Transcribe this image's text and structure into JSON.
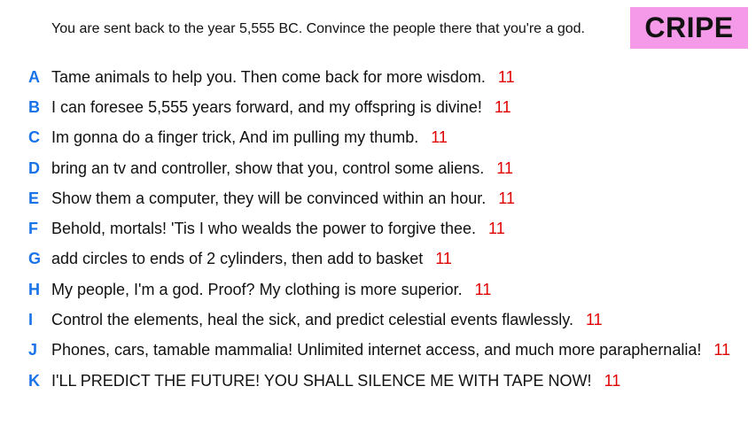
{
  "prompt": "You are sent back to the year 5,555 BC. Convince the people there that you're a god.",
  "logo": "CRIPE",
  "colors": {
    "letter": "#1a73e8",
    "score": "#e00000",
    "logo_bg": "#f49ae8"
  },
  "answers": [
    {
      "letter": "A",
      "text": "Tame animals to help you. Then come back for more wisdom.",
      "score": "11"
    },
    {
      "letter": "B",
      "text": "I can foresee 5,555 years forward, and my offspring is divine!",
      "score": "11"
    },
    {
      "letter": "C",
      "text": "Im gonna do a finger trick, And im pulling my thumb.",
      "score": "11"
    },
    {
      "letter": "D",
      "text": "bring an tv and controller, show that you, control some aliens.",
      "score": "11"
    },
    {
      "letter": "E",
      "text": "Show them a computer, they will be convinced within an hour.",
      "score": "11"
    },
    {
      "letter": "F",
      "text": "Behold, mortals! 'Tis I who wealds the power to forgive thee.",
      "score": "11"
    },
    {
      "letter": "G",
      "text": "add circles to ends of 2 cylinders, then add to basket",
      "score": "11"
    },
    {
      "letter": "H",
      "text": "My people, I'm a god. Proof? My clothing is more superior.",
      "score": "11"
    },
    {
      "letter": "I",
      "text": "Control the elements, heal the sick, and predict celestial events flawlessly.",
      "score": "11"
    },
    {
      "letter": "J",
      "text": "Phones, cars, tamable mammalia! Unlimited internet access, and much more paraphernalia!",
      "score": "11"
    },
    {
      "letter": "K",
      "text": "I'LL PREDICT THE FUTURE! YOU SHALL SILENCE ME WITH TAPE NOW!",
      "score": "11"
    }
  ]
}
